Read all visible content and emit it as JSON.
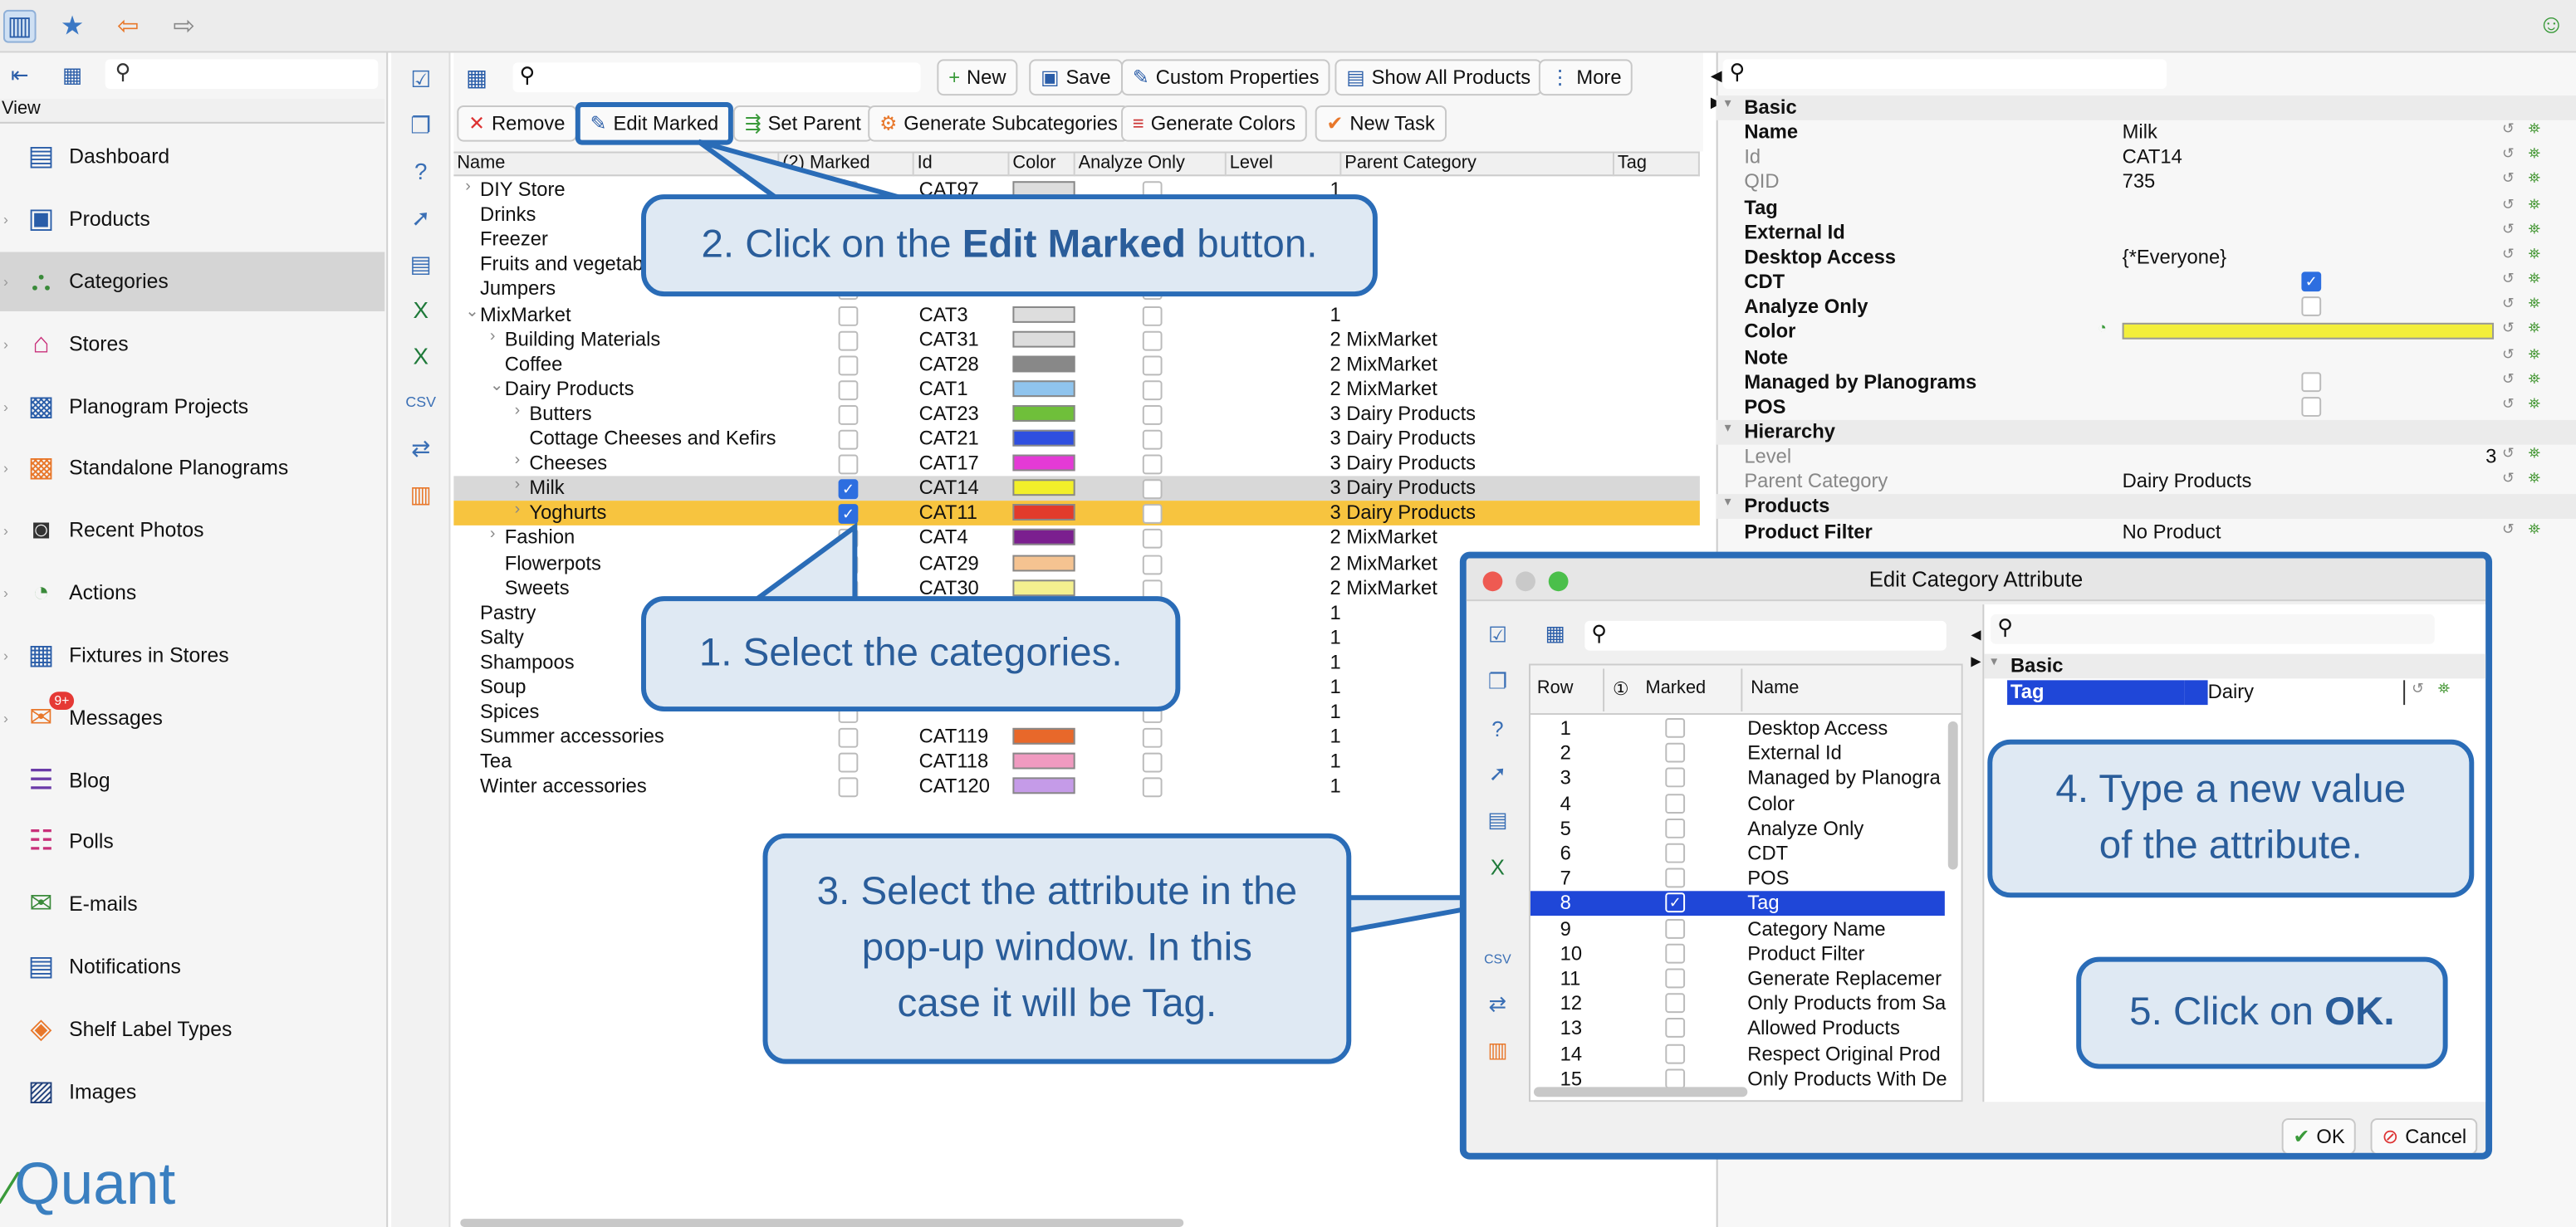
{
  "topbar": {
    "icons": [
      "sidebar-toggle-icon",
      "star-icon",
      "back-arrow-icon",
      "forward-arrow-icon",
      "smiley-icon"
    ]
  },
  "sidebar": {
    "view_label": "View",
    "items": [
      {
        "label": "Dashboard",
        "icon": "dashboard-icon"
      },
      {
        "label": "Products",
        "icon": "products-icon"
      },
      {
        "label": "Categories",
        "icon": "categories-icon"
      },
      {
        "label": "Stores",
        "icon": "stores-icon"
      },
      {
        "label": "Planogram Projects",
        "icon": "planogram-projects-icon"
      },
      {
        "label": "Standalone Planograms",
        "icon": "standalone-planograms-icon"
      },
      {
        "label": "Recent Photos",
        "icon": "camera-icon"
      },
      {
        "label": "Actions",
        "icon": "actions-icon"
      },
      {
        "label": "Fixtures in Stores",
        "icon": "fixtures-icon"
      },
      {
        "label": "Messages",
        "icon": "messages-icon",
        "badge": "9+"
      },
      {
        "label": "Blog",
        "icon": "blog-icon"
      },
      {
        "label": "Polls",
        "icon": "polls-icon"
      },
      {
        "label": "E-mails",
        "icon": "email-icon"
      },
      {
        "label": "Notifications",
        "icon": "notifications-icon"
      },
      {
        "label": "Shelf Label Types",
        "icon": "shelf-label-icon"
      },
      {
        "label": "Images",
        "icon": "images-icon"
      }
    ],
    "logo": "Quant"
  },
  "toolbar": {
    "new": "New",
    "save": "Save",
    "custom_properties": "Custom Properties",
    "show_all_products": "Show All Products",
    "more": "More",
    "remove": "Remove",
    "edit_marked": "Edit Marked",
    "set_parent": "Set Parent",
    "generate_subcategories": "Generate Subcategories",
    "generate_colors": "Generate Colors",
    "new_task": "New Task"
  },
  "table": {
    "headers": {
      "name": "Name",
      "marked": "(2) Marked",
      "id": "Id",
      "color": "Color",
      "analyze_only": "Analyze Only",
      "level": "Level",
      "parent": "Parent Category",
      "tag": "Tag"
    },
    "rows": [
      {
        "name": "DIY Store",
        "id": "CAT97",
        "color": "#dddddd",
        "level": "1",
        "parent": "",
        "marked": false
      },
      {
        "name": "Drinks",
        "id": "",
        "color": "",
        "level": "",
        "parent": "",
        "marked": false
      },
      {
        "name": "Freezer",
        "id": "",
        "color": "",
        "level": "",
        "parent": "",
        "marked": false
      },
      {
        "name": "Fruits and vegetab",
        "id": "",
        "color": "",
        "level": "",
        "parent": "",
        "marked": false
      },
      {
        "name": "Jumpers",
        "id": "",
        "color": "",
        "level": "",
        "parent": "",
        "marked": false
      },
      {
        "name": "MixMarket",
        "id": "CAT3",
        "color": "#dddddd",
        "level": "1",
        "parent": "",
        "marked": false
      },
      {
        "name": "Building Materials",
        "id": "CAT31",
        "color": "#dddddd",
        "level": "2",
        "parent": "MixMarket",
        "marked": false
      },
      {
        "name": "Coffee",
        "id": "CAT28",
        "color": "#888888",
        "level": "2",
        "parent": "MixMarket",
        "marked": false
      },
      {
        "name": "Dairy Products",
        "id": "CAT1",
        "color": "#8fc4ee",
        "level": "2",
        "parent": "MixMarket",
        "marked": false
      },
      {
        "name": "Butters",
        "id": "CAT23",
        "color": "#6fbf3a",
        "level": "3",
        "parent": "Dairy Products",
        "marked": false
      },
      {
        "name": "Cottage Cheeses and Kefirs",
        "id": "CAT21",
        "color": "#2f4fe0",
        "level": "3",
        "parent": "Dairy Products",
        "marked": false
      },
      {
        "name": "Cheeses",
        "id": "CAT17",
        "color": "#e43ad6",
        "level": "3",
        "parent": "Dairy Products",
        "marked": false
      },
      {
        "name": "Milk",
        "id": "CAT14",
        "color": "#f2ef2a",
        "level": "3",
        "parent": "Dairy Products",
        "marked": true
      },
      {
        "name": "Yoghurts",
        "id": "CAT11",
        "color": "#e23b2b",
        "level": "3",
        "parent": "Dairy Products",
        "marked": true
      },
      {
        "name": "Fashion",
        "id": "CAT4",
        "color": "#7b1f8f",
        "level": "2",
        "parent": "MixMarket",
        "marked": false
      },
      {
        "name": "Flowerpots",
        "id": "CAT29",
        "color": "#f5c391",
        "level": "2",
        "parent": "MixMarket",
        "marked": false
      },
      {
        "name": "Sweets",
        "id": "CAT30",
        "color": "#f4f08f",
        "level": "2",
        "parent": "MixMarket",
        "marked": false
      },
      {
        "name": "Pastry",
        "id": "",
        "color": "",
        "level": "1",
        "parent": "",
        "marked": false
      },
      {
        "name": "Salty",
        "id": "",
        "color": "",
        "level": "1",
        "parent": "",
        "marked": false
      },
      {
        "name": "Shampoos",
        "id": "",
        "color": "",
        "level": "1",
        "parent": "",
        "marked": false
      },
      {
        "name": "Soup",
        "id": "",
        "color": "",
        "level": "1",
        "parent": "",
        "marked": false
      },
      {
        "name": "Spices",
        "id": "",
        "color": "",
        "level": "1",
        "parent": "",
        "marked": false
      },
      {
        "name": "Summer accessories",
        "id": "CAT119",
        "color": "#e8682a",
        "level": "1",
        "parent": "",
        "marked": false
      },
      {
        "name": "Tea",
        "id": "CAT118",
        "color": "#f09ac0",
        "level": "1",
        "parent": "",
        "marked": false
      },
      {
        "name": "Winter accessories",
        "id": "CAT120",
        "color": "#c59be8",
        "level": "1",
        "parent": "",
        "marked": false
      }
    ]
  },
  "properties": {
    "rows": [
      {
        "key": "Basic",
        "value": "",
        "group": true
      },
      {
        "key": "Name",
        "value": "Milk"
      },
      {
        "key": "Id",
        "value": "CAT14",
        "dim": true
      },
      {
        "key": "QID",
        "value": "735",
        "dim": true
      },
      {
        "key": "Tag",
        "value": ""
      },
      {
        "key": "External Id",
        "value": ""
      },
      {
        "key": "Desktop Access",
        "value": "{*Everyone}"
      },
      {
        "key": "CDT",
        "value": "",
        "check": "on"
      },
      {
        "key": "Analyze Only",
        "value": "",
        "check": "off"
      },
      {
        "key": "Color",
        "value": "",
        "color": "#f3ef3a"
      },
      {
        "key": "Note",
        "value": ""
      },
      {
        "key": "Managed by Planograms",
        "value": "",
        "check": "off"
      },
      {
        "key": "POS",
        "value": "",
        "check": "off"
      },
      {
        "key": "Hierarchy",
        "value": "",
        "group": true
      },
      {
        "key": "Level",
        "value": "3",
        "dim": true,
        "right": true
      },
      {
        "key": "Parent Category",
        "value": "Dairy Products",
        "dim": true
      },
      {
        "key": "Products",
        "value": "",
        "group": true
      },
      {
        "key": "Product Filter",
        "value": "No Product"
      }
    ]
  },
  "callouts": {
    "c1": "1. Select the categories.",
    "c2_pre": "2. Click on the ",
    "c2_bold": "Edit Marked",
    "c2_post": " button.",
    "c3_line1": "3. Select the attribute in the",
    "c3_line2": "pop-up window. In this",
    "c3_line3": "case it will be Tag.",
    "c4_line1": "4. Type a new value",
    "c4_line2": "of the attribute.",
    "c5_pre": "5. Click on ",
    "c5_bold": "OK."
  },
  "dialog": {
    "title": "Edit Category Attribute",
    "headers": {
      "row": "Row",
      "marked": "Marked",
      "name": "Name"
    },
    "rows": [
      {
        "n": "1",
        "name": "Desktop Access",
        "sel": false
      },
      {
        "n": "2",
        "name": "External Id",
        "sel": false
      },
      {
        "n": "3",
        "name": "Managed by Planogra",
        "sel": false
      },
      {
        "n": "4",
        "name": "Color",
        "sel": false
      },
      {
        "n": "5",
        "name": "Analyze Only",
        "sel": false
      },
      {
        "n": "6",
        "name": "CDT",
        "sel": false
      },
      {
        "n": "7",
        "name": "POS",
        "sel": false
      },
      {
        "n": "8",
        "name": "Tag",
        "sel": true
      },
      {
        "n": "9",
        "name": "Category Name",
        "sel": false
      },
      {
        "n": "10",
        "name": "Product Filter",
        "sel": false
      },
      {
        "n": "11",
        "name": "Generate Replacemer",
        "sel": false
      },
      {
        "n": "12",
        "name": "Only Products from Sa",
        "sel": false
      },
      {
        "n": "13",
        "name": "Allowed Products",
        "sel": false
      },
      {
        "n": "14",
        "name": "Respect Original Prod",
        "sel": false
      },
      {
        "n": "15",
        "name": "Only Products With De",
        "sel": false
      }
    ],
    "right_group": "Basic",
    "tag_key": "Tag",
    "tag_value": "Dairy",
    "ok": "OK",
    "cancel": "Cancel"
  }
}
